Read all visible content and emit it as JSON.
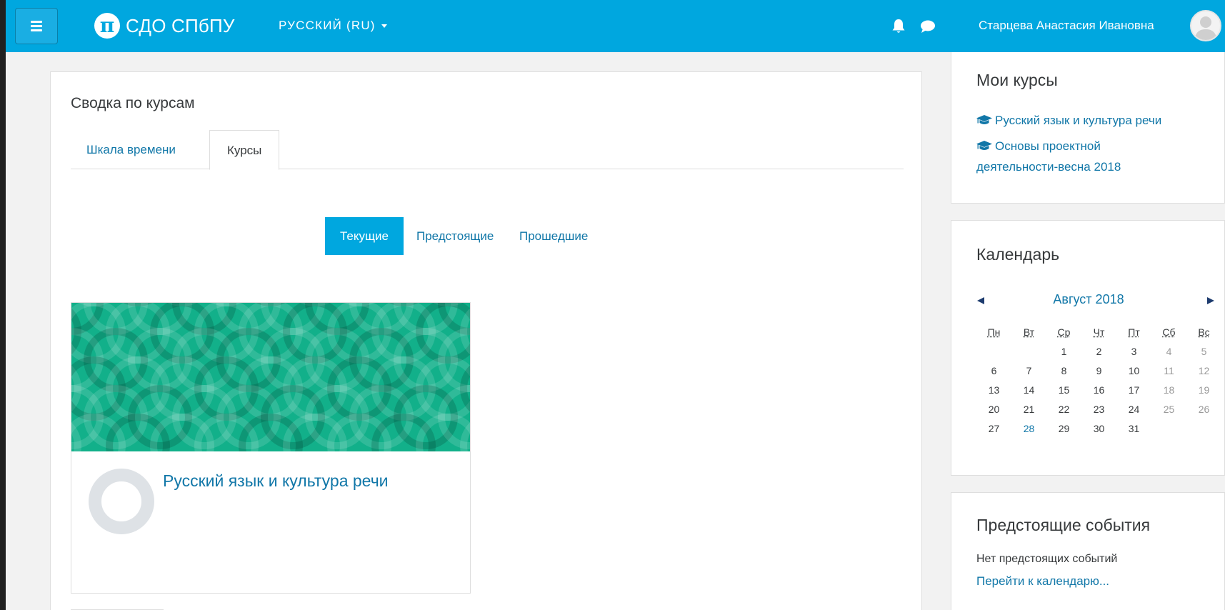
{
  "header": {
    "logo_glyph": "π",
    "logo_text": "СДО СПбПУ",
    "language": "РУССКИЙ (RU)",
    "user_name": "Старцева Анастасия Ивановна",
    "bar_color": "#00a7df"
  },
  "overview": {
    "title": "Сводка по курсам",
    "tabs": [
      {
        "label": "Шкала времени",
        "active": false
      },
      {
        "label": "Курсы",
        "active": true
      }
    ],
    "filters": [
      {
        "label": "Текущие",
        "active": true
      },
      {
        "label": "Предстоящие",
        "active": false
      },
      {
        "label": "Прошедшие",
        "active": false
      }
    ],
    "course": {
      "name": "Русский язык и культура речи",
      "progress_label": "0%",
      "progress": 0,
      "image_color": "#12b08a"
    }
  },
  "my_courses": {
    "title": "Мои курсы",
    "items": [
      {
        "line1": "Русский язык и культура речи",
        "line2": ""
      },
      {
        "line1": "Основы проектной",
        "line2": "деятельности-весна 2018"
      }
    ]
  },
  "calendar": {
    "title": "Календарь",
    "month": "Август 2018",
    "prev_glyph": "◀",
    "next_glyph": "▶",
    "weekdays": [
      "Пн",
      "Вт",
      "Ср",
      "Чт",
      "Пт",
      "Сб",
      "Вс"
    ],
    "weeks": [
      [
        "",
        "",
        "1",
        "2",
        "3",
        "4",
        "5"
      ],
      [
        "6",
        "7",
        "8",
        "9",
        "10",
        "11",
        "12"
      ],
      [
        "13",
        "14",
        "15",
        "16",
        "17",
        "18",
        "19"
      ],
      [
        "20",
        "21",
        "22",
        "23",
        "24",
        "25",
        "26"
      ],
      [
        "27",
        "28",
        "29",
        "30",
        "31",
        "",
        ""
      ]
    ],
    "today": "28"
  },
  "events": {
    "title": "Предстоящие события",
    "empty_text": "Нет предстоящих событий",
    "link": "Перейти к календарю..."
  }
}
